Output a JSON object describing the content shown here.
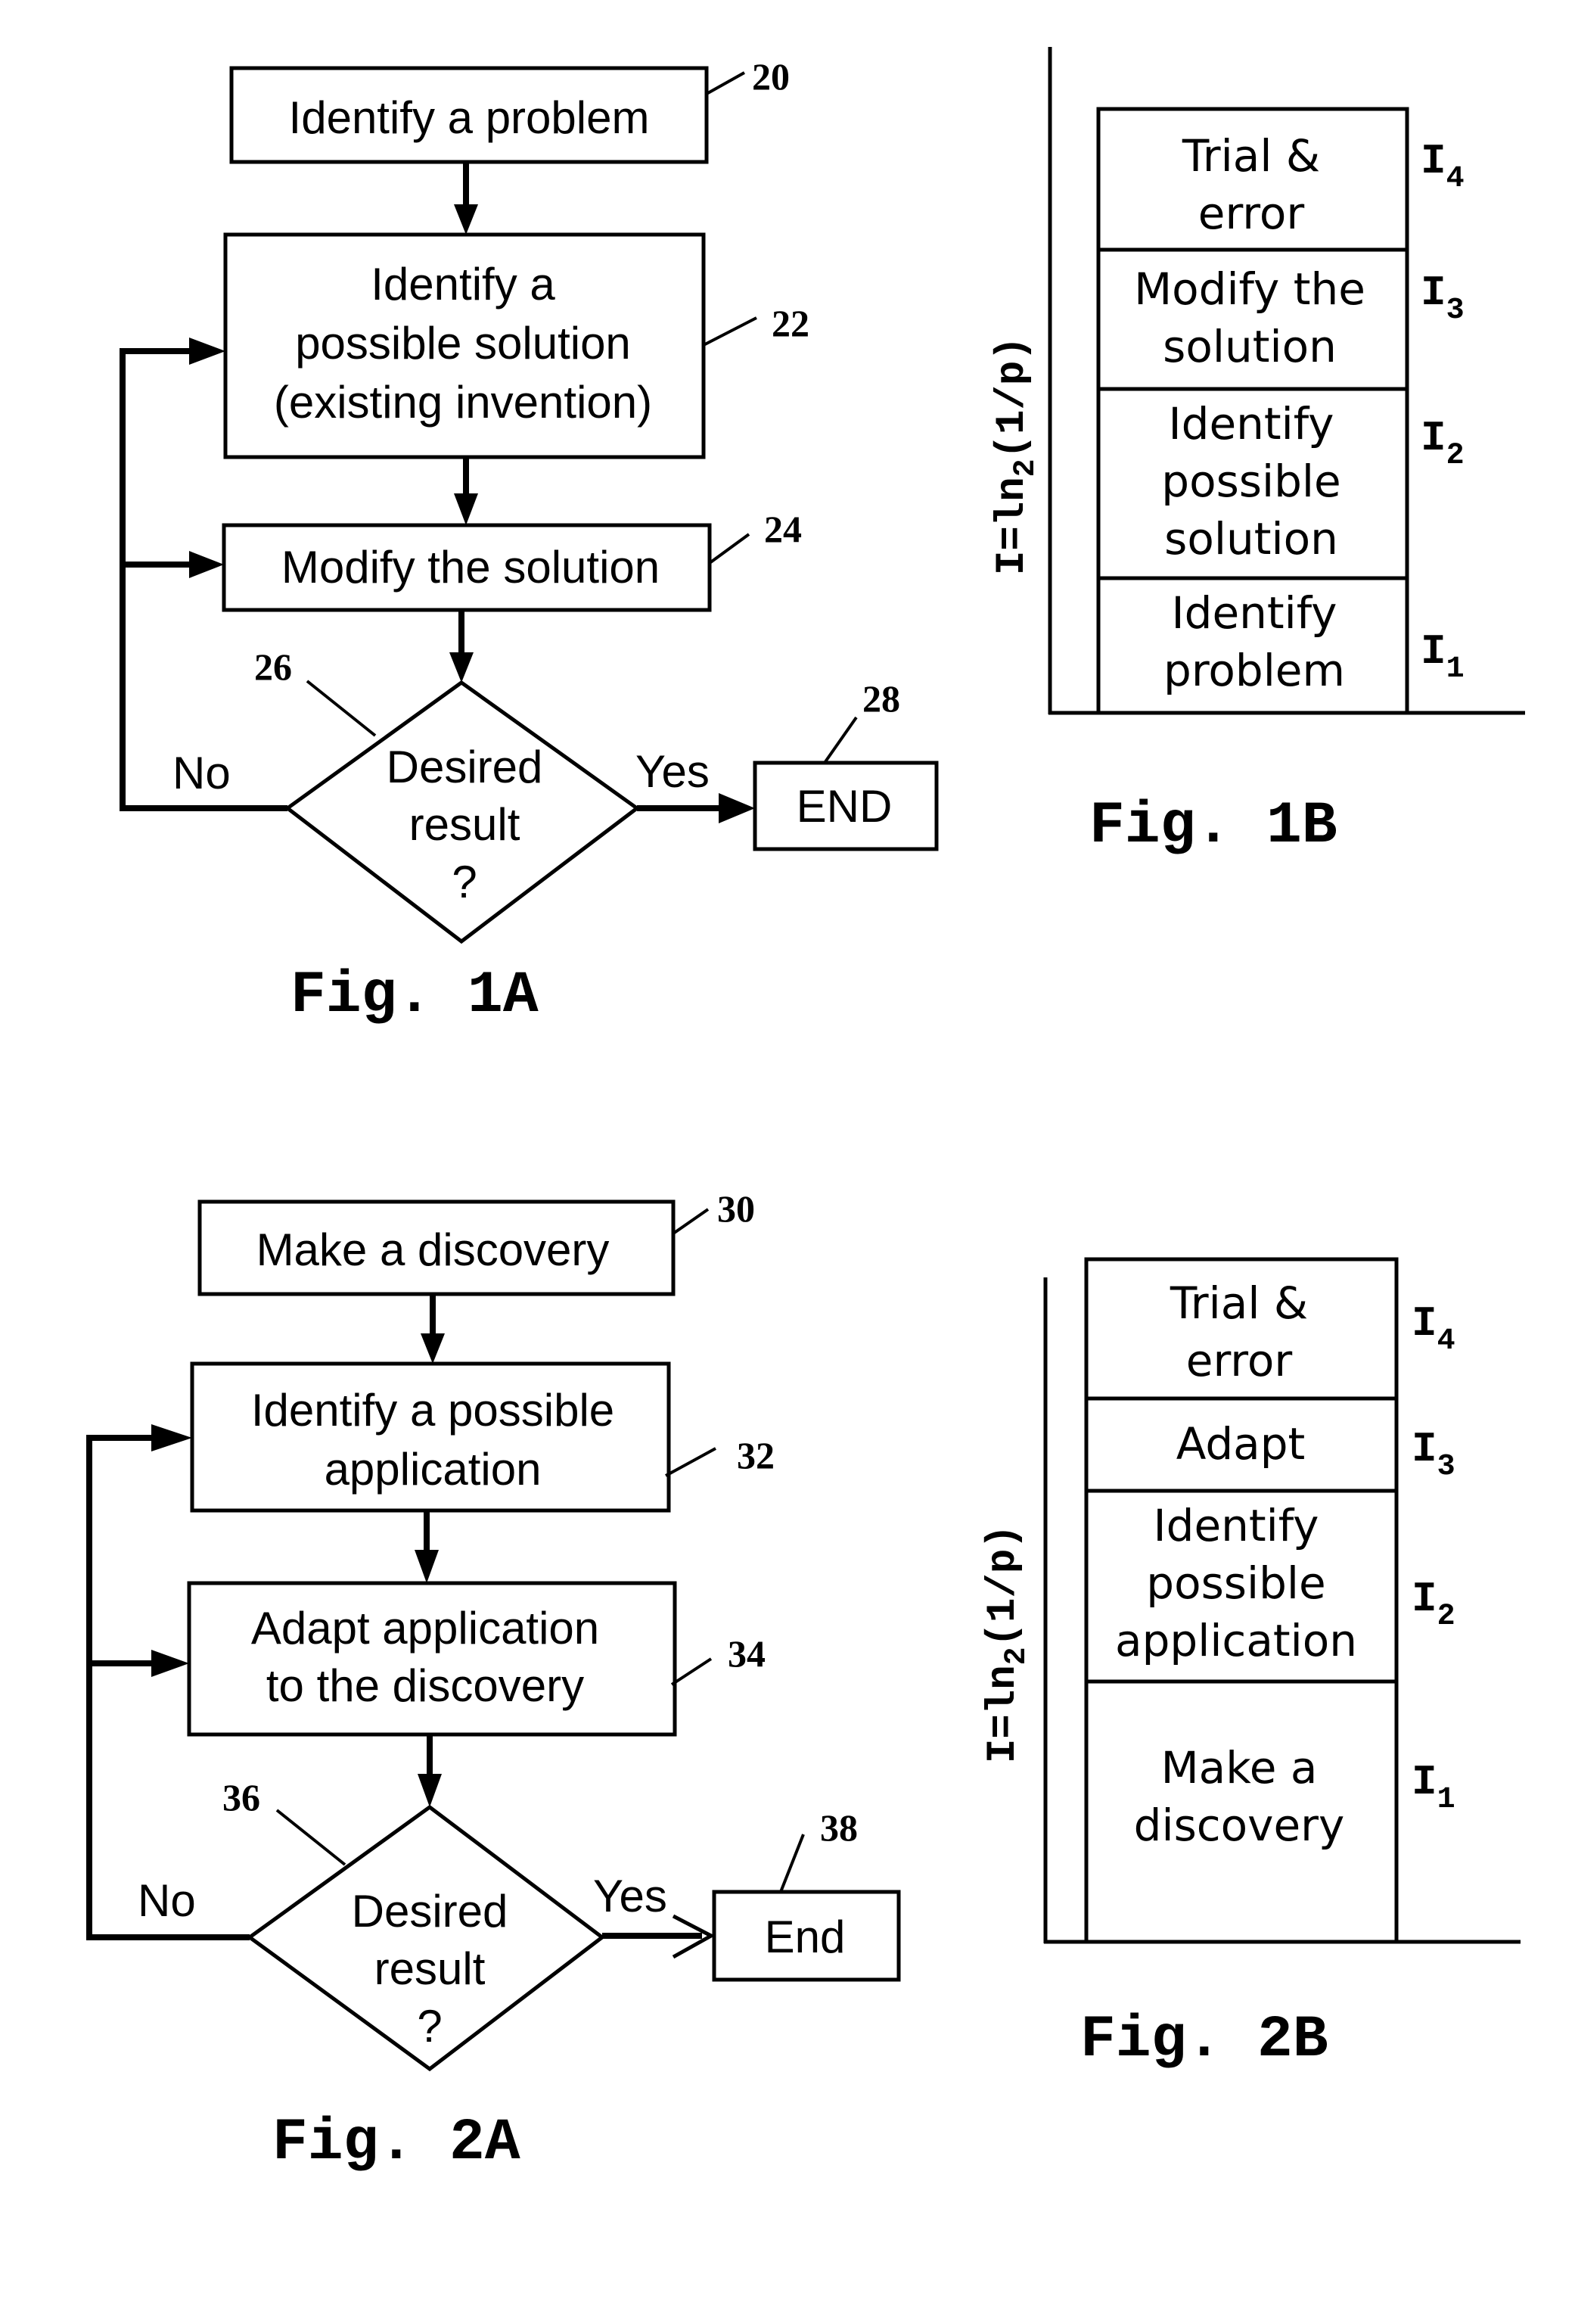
{
  "fig1a": {
    "caption": "Fig. 1A",
    "steps": [
      {
        "ref": "20",
        "lines": [
          "Identify a problem"
        ]
      },
      {
        "ref": "22",
        "lines": [
          "Identify a",
          "possible solution",
          "(existing invention)"
        ]
      },
      {
        "ref": "24",
        "lines": [
          "Modify the solution"
        ]
      }
    ],
    "decision": {
      "ref": "26",
      "lines": [
        "Desired",
        "result",
        "?"
      ],
      "no_label": "No",
      "yes_label": "Yes"
    },
    "end": {
      "ref": "28",
      "label": "END"
    }
  },
  "fig1b": {
    "caption": "Fig. 1B",
    "axis_label": {
      "main": "I=ln",
      "sub": "2",
      "rest": "(1/p)"
    },
    "segments": [
      {
        "lines": [
          "Trial &",
          "error"
        ],
        "level": "I",
        "sub": "4"
      },
      {
        "lines": [
          "Modify the",
          "solution"
        ],
        "level": "I",
        "sub": "3"
      },
      {
        "lines": [
          "Identify",
          "possible",
          "solution"
        ],
        "level": "I",
        "sub": "2"
      },
      {
        "lines": [
          "Identify",
          "problem"
        ],
        "level": "I",
        "sub": "1"
      }
    ]
  },
  "fig2a": {
    "caption": "Fig. 2A",
    "steps": [
      {
        "ref": "30",
        "lines": [
          "Make a discovery"
        ]
      },
      {
        "ref": "32",
        "lines": [
          "Identify a possible",
          "application"
        ]
      },
      {
        "ref": "34",
        "lines": [
          "Adapt application",
          "to the discovery"
        ]
      }
    ],
    "decision": {
      "ref": "36",
      "lines": [
        "Desired",
        "result",
        "?"
      ],
      "no_label": "No",
      "yes_label": "Yes"
    },
    "end": {
      "ref": "38",
      "label": "End"
    }
  },
  "fig2b": {
    "caption": "Fig. 2B",
    "axis_label": {
      "main": "I=ln",
      "sub": "2",
      "rest": "(1/p)"
    },
    "segments": [
      {
        "lines": [
          "Trial &",
          "error"
        ],
        "level": "I",
        "sub": "4"
      },
      {
        "lines": [
          "Adapt"
        ],
        "level": "I",
        "sub": "3"
      },
      {
        "lines": [
          "Identify",
          "possible",
          "application"
        ],
        "level": "I",
        "sub": "2"
      },
      {
        "lines": [
          "Make a",
          "discovery"
        ],
        "level": "I",
        "sub": "1"
      }
    ]
  }
}
